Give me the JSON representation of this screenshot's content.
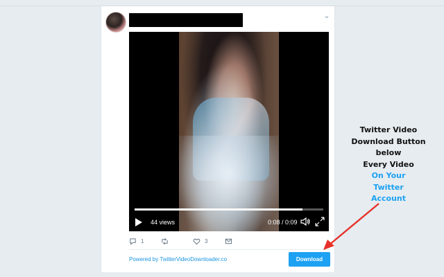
{
  "tweet": {
    "video": {
      "views_label": "44 views",
      "time_label": "0:08 / 0:09",
      "progress_fraction": 0.89
    },
    "actions": {
      "reply_count": "1",
      "retweet_count": "",
      "like_count": "3"
    },
    "footer": {
      "powered_by": "Powered by TwitterVideoDownloader.co",
      "download_label": "Download"
    }
  },
  "callout": {
    "lines_black": [
      "Twitter Video",
      "Download Button",
      "below",
      "Every Video"
    ],
    "lines_blue": [
      "On Your",
      "Twitter",
      "Account"
    ]
  },
  "colors": {
    "accent": "#1da1f2",
    "link": "#1b95e0",
    "arrow": "#e8302a",
    "background": "#e6ecf0"
  },
  "icons": {
    "play": "play-icon",
    "volume": "volume-icon",
    "fullscreen": "fullscreen-icon",
    "reply": "reply-icon",
    "retweet": "retweet-icon",
    "like": "heart-icon",
    "message": "envelope-icon",
    "caret": "chevron-down-icon"
  }
}
